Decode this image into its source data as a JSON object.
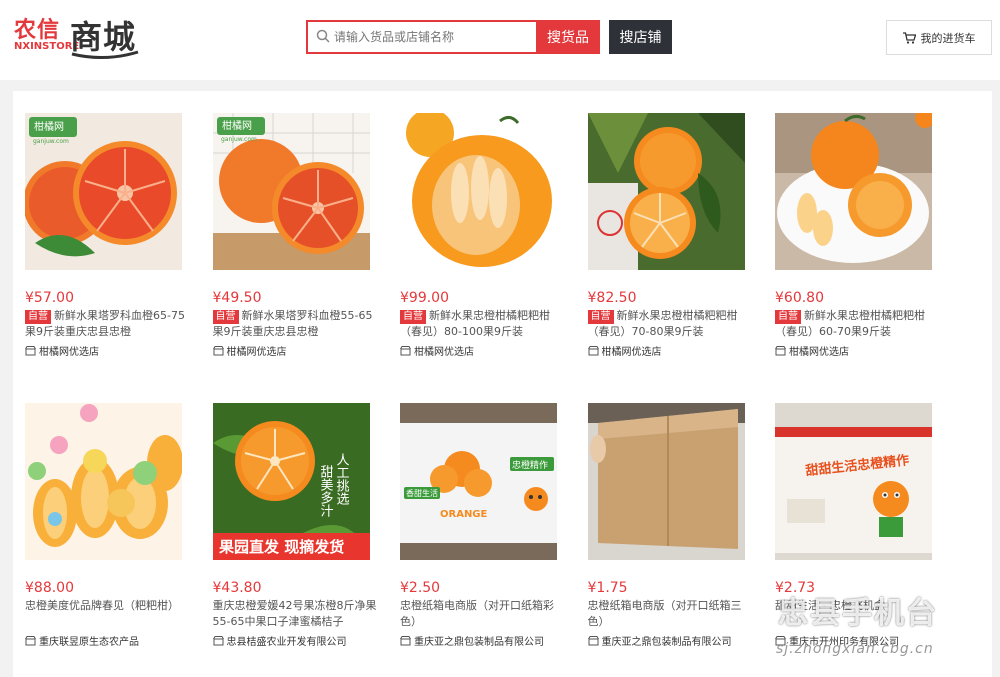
{
  "header": {
    "logo_cn_left": "农信",
    "logo_en": "NXINSTORE",
    "logo_cn_right": "商城",
    "search_placeholder": "请输入货品或店铺名称",
    "search_goods_label": "搜货品",
    "search_store_label": "搜店铺",
    "cart_label": "我的进货车"
  },
  "products": [
    {
      "price": "¥57.00",
      "tag": "自营",
      "title": "新鲜水果塔罗科血橙65-75果9斤装重庆忠县忠橙",
      "shop": "柑橘网优选店",
      "badge": "柑橘网",
      "badge_sub": "ganjuw.com"
    },
    {
      "price": "¥49.50",
      "tag": "自营",
      "title": "新鲜水果塔罗科血橙55-65果9斤装重庆忠县忠橙",
      "shop": "柑橘网优选店",
      "badge": "柑橘网",
      "badge_sub": "ganjuw.com"
    },
    {
      "price": "¥99.00",
      "tag": "自营",
      "title": "新鲜水果忠橙柑橘粑粑柑（春见）80-100果9斤装",
      "shop": "柑橘网优选店"
    },
    {
      "price": "¥82.50",
      "tag": "自营",
      "title": "新鲜水果忠橙柑橘粑粑柑（春见）70-80果9斤装",
      "shop": "柑橘网优选店"
    },
    {
      "price": "¥60.80",
      "tag": "自营",
      "title": "新鲜水果忠橙柑橘粑粑柑（春见）60-70果9斤装",
      "shop": "柑橘网优选店"
    },
    {
      "price": "¥88.00",
      "tag": "",
      "title": "忠橙美度优品牌春见（粑粑柑）",
      "shop": "重庆联昱原生态农产品"
    },
    {
      "price": "¥43.80",
      "tag": "",
      "title": "重庆忠橙爱媛42号果冻橙8斤净果55-65中果口子津蜜橘桔子",
      "shop": "忠县桔盛农业开发有限公司",
      "banner": "果园直发  现摘发货",
      "vertical1": "人工挑选",
      "vertical2": "甜美多汁"
    },
    {
      "price": "¥2.50",
      "tag": "",
      "title": "忠橙纸箱电商版（对开口纸箱彩色）",
      "shop": "重庆亚之鼎包装制品有限公司",
      "box_text": "忠橙精作",
      "box_sub": "ORANGE",
      "box_brand": "香甜生活"
    },
    {
      "price": "¥1.75",
      "tag": "",
      "title": "忠橙纸箱电商版（对开口纸箱三色）",
      "shop": "重庆亚之鼎包装制品有限公司"
    },
    {
      "price": "¥2.73",
      "tag": "",
      "title": "甜甜生活 - 忠橙飞机盒",
      "shop": "重庆市开州印务有限公司",
      "box_text": "甜甜生活忠橙精作"
    }
  ],
  "watermark": {
    "main": "忠县手机台",
    "url": "sj.zhongxian.cbg.cn"
  }
}
